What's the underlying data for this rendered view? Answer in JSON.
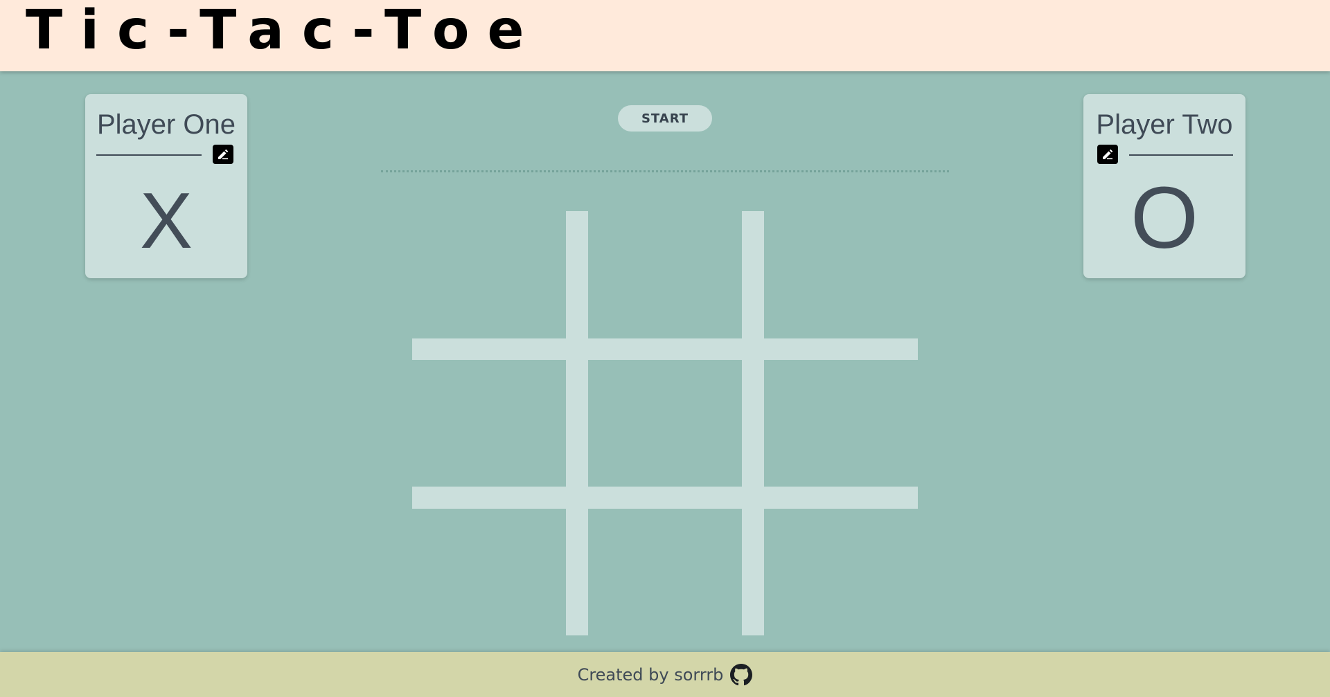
{
  "header": {
    "title": "Tic-Tac-Toe"
  },
  "players": [
    {
      "name": "Player One",
      "mark": "X",
      "edit_icon": "edit-icon"
    },
    {
      "name": "Player Two",
      "mark": "O",
      "edit_icon": "edit-icon"
    }
  ],
  "controls": {
    "start_label": "START"
  },
  "status": {
    "message": ""
  },
  "board": {
    "cells": [
      "",
      "",
      "",
      "",
      "",
      "",
      "",
      "",
      ""
    ]
  },
  "footer": {
    "credit": "Created by sorrrb",
    "icon": "github-icon"
  },
  "colors": {
    "header_bg": "#ffeadb",
    "page_bg": "#97bfb7",
    "card_bg": "#cbdfdc",
    "footer_bg": "#d3d6a9",
    "text": "#3f4a56"
  }
}
